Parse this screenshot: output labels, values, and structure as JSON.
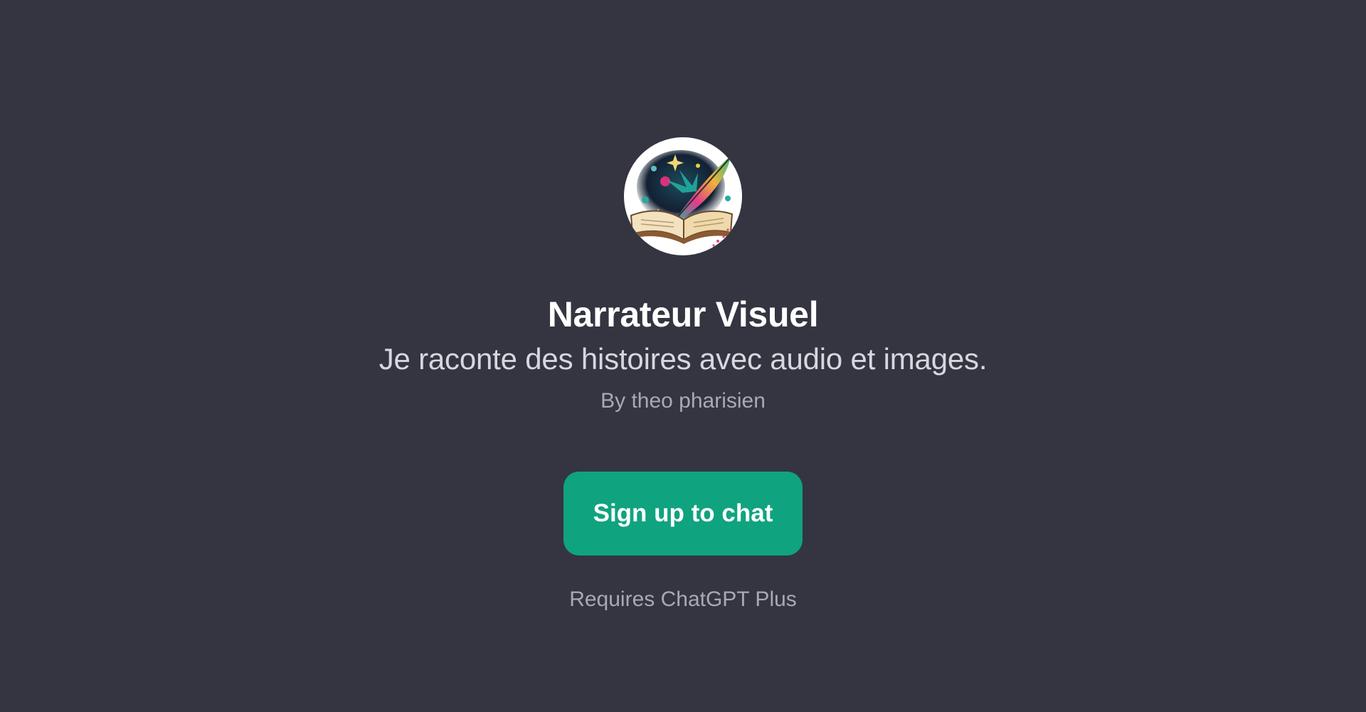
{
  "gpt": {
    "name": "Narrateur Visuel",
    "description": "Je raconte des histoires avec audio et images.",
    "author": "By theo pharisien",
    "avatar_icon": "book-quill-illustration-icon"
  },
  "actions": {
    "signup_label": "Sign up to chat"
  },
  "footer": {
    "requirement": "Requires ChatGPT Plus"
  },
  "colors": {
    "background": "#343541",
    "accent": "#10a37f",
    "title": "#ffffff",
    "muted": "#a9a9b3"
  }
}
